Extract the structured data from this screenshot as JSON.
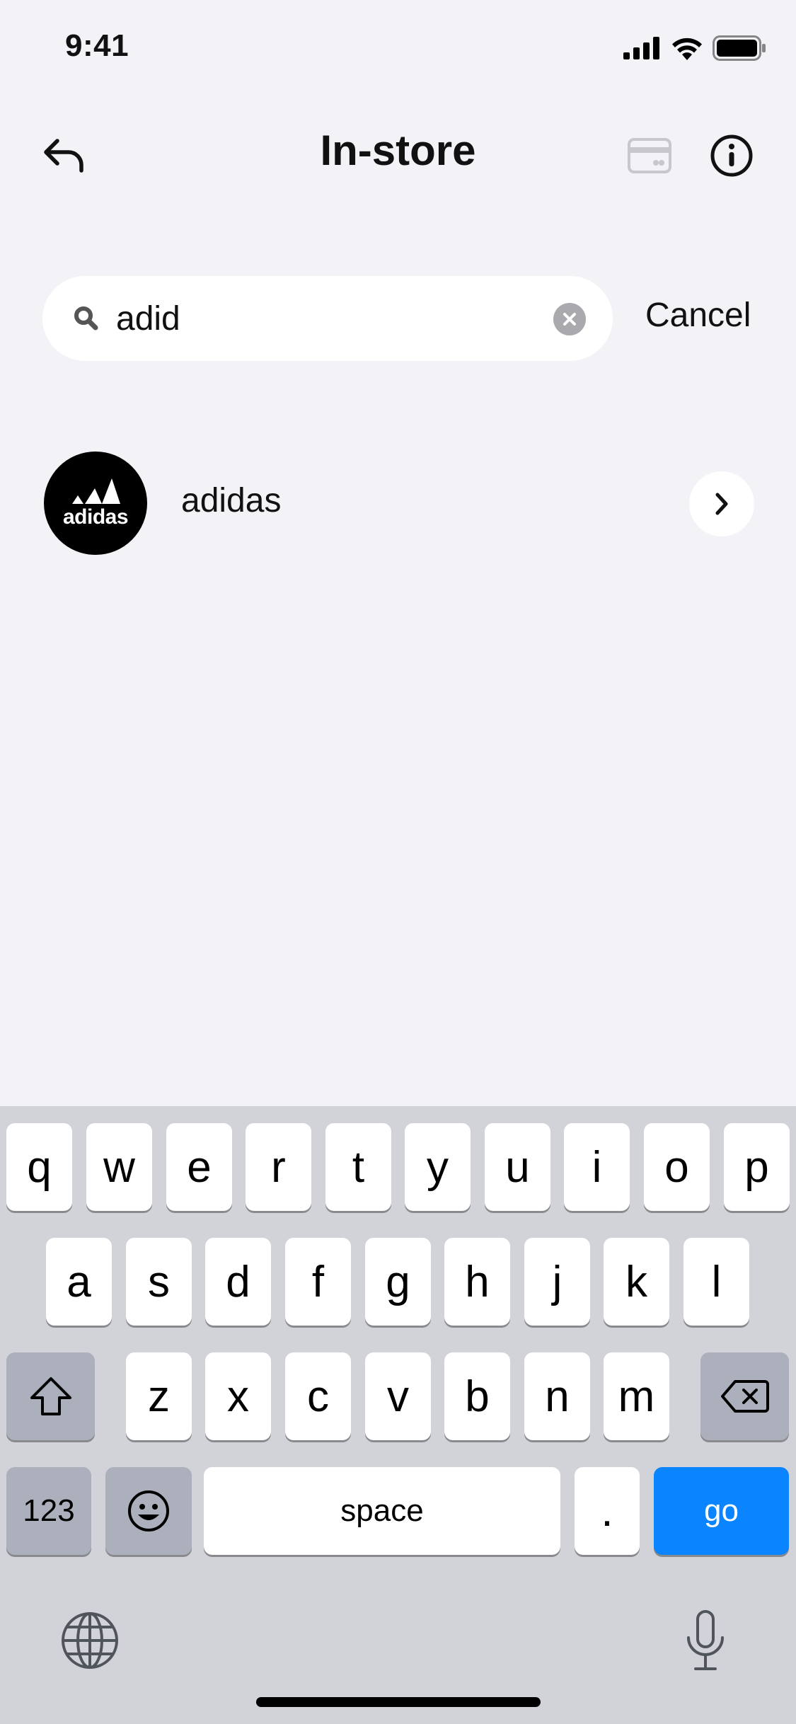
{
  "status_bar": {
    "time": "9:41"
  },
  "header": {
    "title": "In-store"
  },
  "search": {
    "value": "adid",
    "cancel_label": "Cancel"
  },
  "results": [
    {
      "name": "adidas",
      "logo_text": "adidas"
    }
  ],
  "keyboard": {
    "row1": [
      "q",
      "w",
      "e",
      "r",
      "t",
      "y",
      "u",
      "i",
      "o",
      "p"
    ],
    "row2": [
      "a",
      "s",
      "d",
      "f",
      "g",
      "h",
      "j",
      "k",
      "l"
    ],
    "row3": [
      "z",
      "x",
      "c",
      "v",
      "b",
      "n",
      "m"
    ],
    "numbers_label": "123",
    "space_label": "space",
    "period_label": ".",
    "go_label": "go"
  },
  "colors": {
    "accent": "#0a84ff",
    "background": "#f2f2f7",
    "keyboard_bg": "#d1d3d9"
  }
}
